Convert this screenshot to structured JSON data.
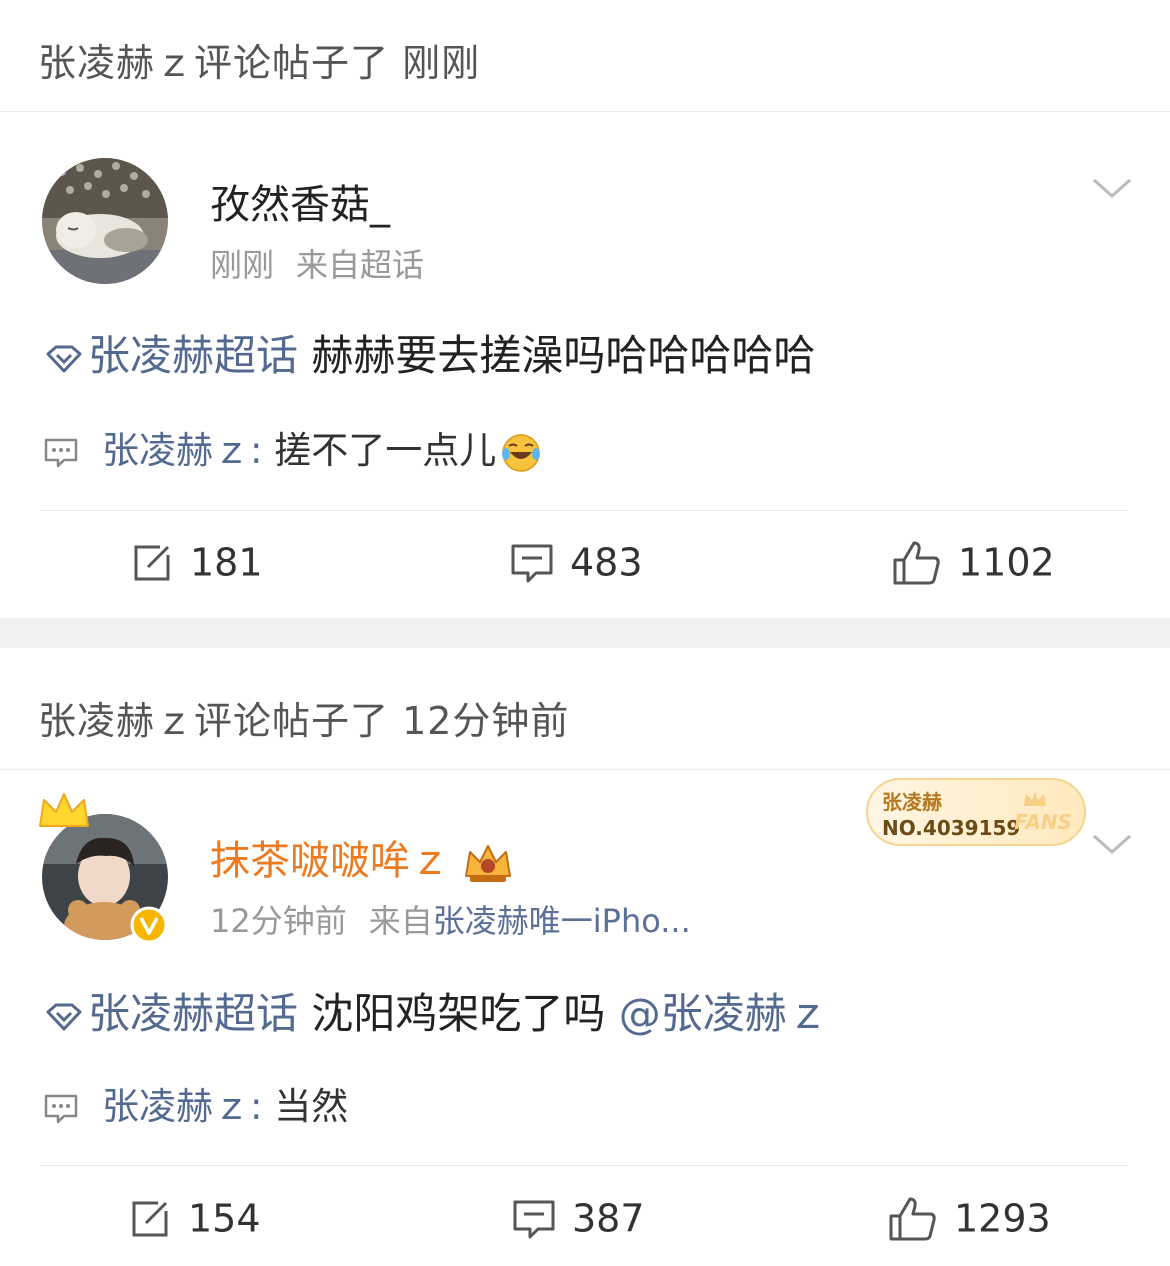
{
  "posts": [
    {
      "header": "张凌赫ｚ评论帖子了 刚刚",
      "author": "孜然香菇_",
      "time": "刚刚",
      "source": "来自超话",
      "topic": "张凌赫超话",
      "content": " 赫赫要去搓澡吗哈哈哈哈哈",
      "comment_user": "张凌赫ｚ:",
      "comment_text": " 搓不了一点儿",
      "reposts": "181",
      "comments": "483",
      "likes": "1102"
    },
    {
      "header": "张凌赫ｚ评论帖子了 12分钟前",
      "author": "抹茶啵啵哞ｚ",
      "time": "12分钟前",
      "source_prefix": "来自",
      "source_link": "张凌赫唯一iPho...",
      "topic": "张凌赫超话",
      "content": " 沈阳鸡架吃了吗 ",
      "mention": "@张凌赫ｚ",
      "comment_user": "张凌赫ｚ:",
      "comment_text": " 当然",
      "reposts": "154",
      "comments": "387",
      "likes": "1293",
      "fans_badge": {
        "name": "张凌赫",
        "number": "NO.4039159",
        "label": "FANS"
      }
    }
  ],
  "icons": {
    "topic": "topic-diamond-icon",
    "comment": "comment-bubble-icon",
    "repost": "repost-icon",
    "like": "thumbs-up-icon",
    "chevron": "chevron-down-icon",
    "crown": "crown-icon",
    "verified": "verified-v-icon"
  },
  "colors": {
    "link": "#53698f",
    "orange_name": "#ee7a20",
    "meta": "#999999"
  }
}
